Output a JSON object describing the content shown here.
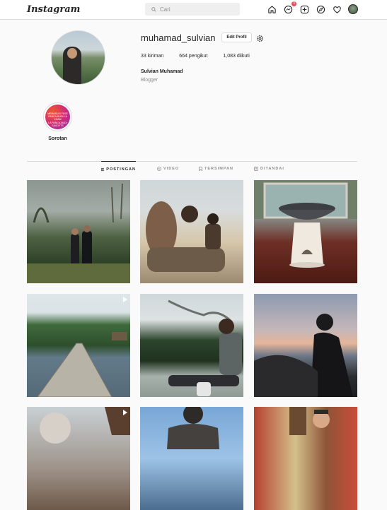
{
  "header": {
    "logo": "Instagram",
    "search_placeholder": "Cari",
    "notification_count": "3"
  },
  "profile": {
    "username": "muhamad_sulvian",
    "edit_label": "Edit Profil",
    "stats": {
      "posts": "33 kiriman",
      "followers": "664 pengikut",
      "following": "1,083 diikuti"
    },
    "full_name": "Sulvian Muhamad",
    "category": "Blogger"
  },
  "highlights": [
    {
      "label": "Sorotan",
      "cover_text": "MEMASUKI FASE\nPANCA-BUDI LA CHAM\nLA PANCA-BUDI SAUDYTS"
    }
  ],
  "tabs": [
    {
      "label": "POSTINGAN",
      "icon": "grid-icon",
      "active": true
    },
    {
      "label": "VIDEO",
      "icon": "video-icon",
      "active": false
    },
    {
      "label": "TERSIMPAN",
      "icon": "bookmark-icon",
      "active": false
    },
    {
      "label": "DITANDAI",
      "icon": "tag-icon",
      "active": false
    }
  ],
  "posts": [
    {
      "scene": "misty-forest-couple",
      "video": false
    },
    {
      "scene": "beach-two-boys",
      "video": false
    },
    {
      "scene": "clay-pot-on-stand",
      "video": false
    },
    {
      "scene": "wooden-pier-island",
      "video": true
    },
    {
      "scene": "boy-sitting-by-river",
      "video": false
    },
    {
      "scene": "sunset-silhouette-rocks",
      "video": false
    },
    {
      "scene": "person-outdoor-sky",
      "video": true
    },
    {
      "scene": "person-back-blue-sky",
      "video": false
    },
    {
      "scene": "festival-masks",
      "video": false
    }
  ],
  "colors": {
    "badge": "#ed4956",
    "text": "#262626",
    "muted": "#8e8e8e",
    "border": "#dbdbdb"
  }
}
